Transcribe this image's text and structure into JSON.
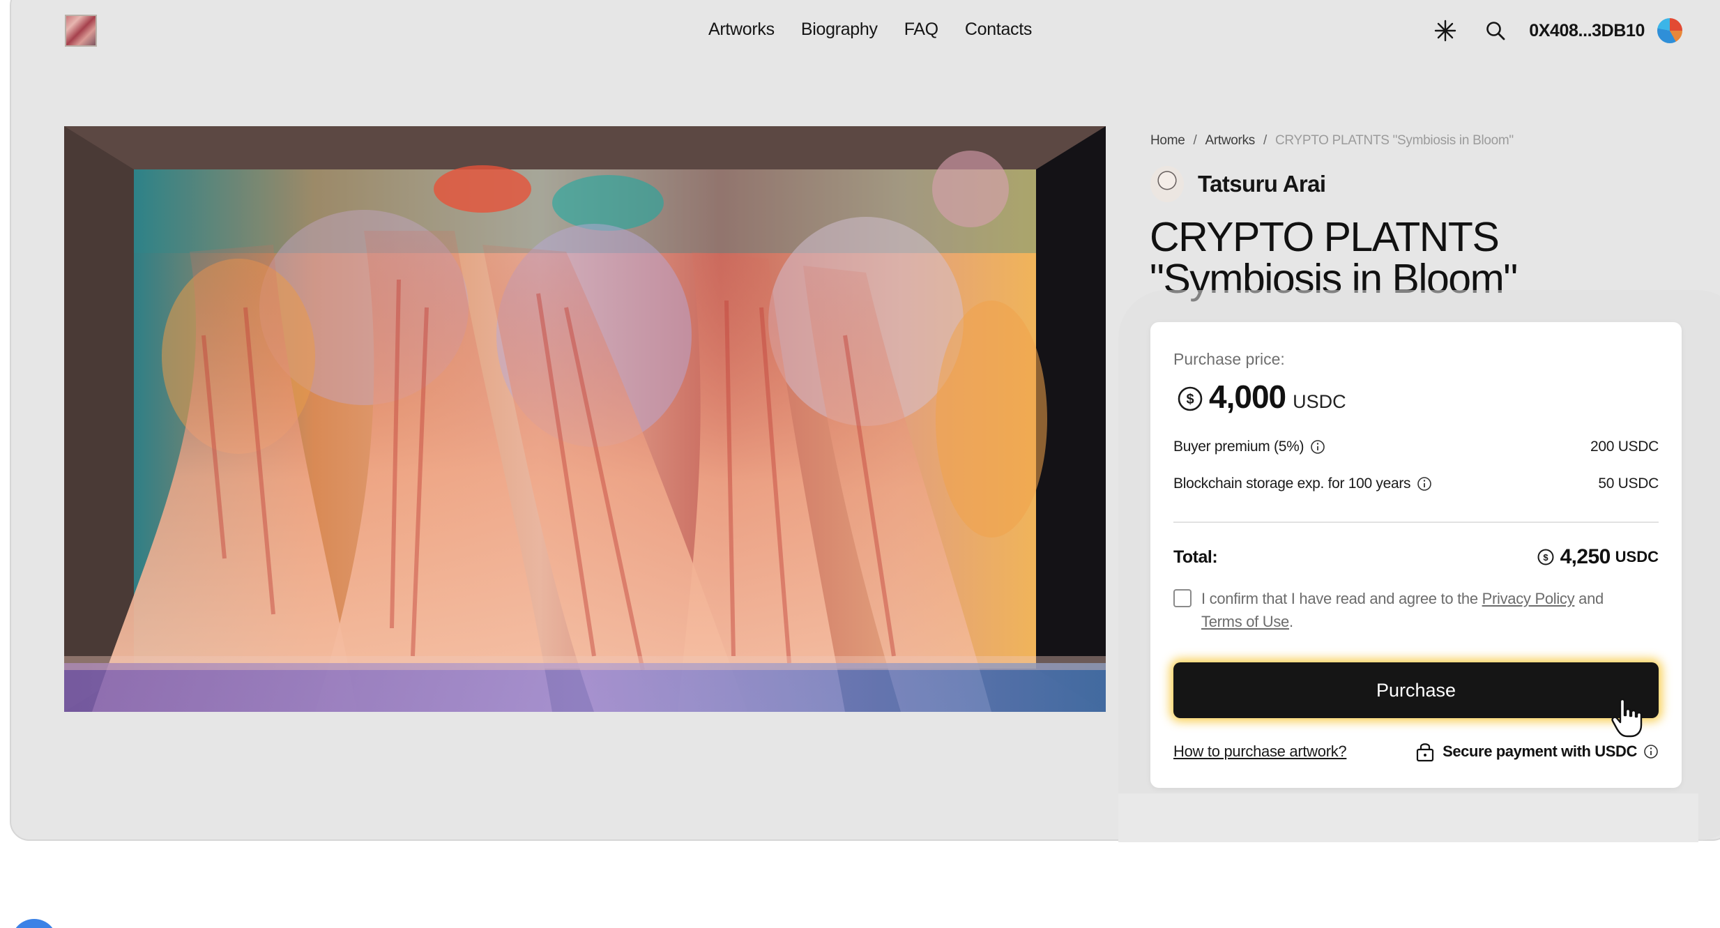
{
  "nav": {
    "items": [
      "Artworks",
      "Biography",
      "FAQ",
      "Contacts"
    ],
    "wallet": "0X408...3DB10"
  },
  "breadcrumb": {
    "home": "Home",
    "separator": "/",
    "section": "Artworks",
    "current": "CRYPTO PLATNTS \"Symbiosis in Bloom\""
  },
  "artist": {
    "name": "Tatsuru Arai"
  },
  "artwork": {
    "title_line1": "CRYPTO PLATNTS",
    "title_line2": "\"Symbiosis in Bloom\""
  },
  "purchase": {
    "price_label": "Purchase price:",
    "price": "4,000",
    "currency": "USDC",
    "fees": [
      {
        "label": "Buyer premium (5%)",
        "value": "200 USDC"
      },
      {
        "label": "Blockchain storage exp. for 100 years",
        "value": "50 USDC"
      }
    ],
    "total_label": "Total:",
    "total": "4,250",
    "total_currency": "USDC",
    "consent_prefix": "I confirm that I have read and agree to the ",
    "privacy_link": "Privacy Policy",
    "consent_and": " and ",
    "terms_link": "Terms of Use",
    "consent_suffix": ".",
    "checkbox_checked": false,
    "button_label": "Purchase",
    "howto_link": "How to purchase artwork?",
    "secure_label": "Secure payment with USDC"
  },
  "colors": {
    "frame": "#e6e6e6",
    "button": "#151515",
    "button_glow": "#f7c01e"
  },
  "icons": [
    "sun-icon",
    "search-icon",
    "usdc-coin-icon",
    "info-icon",
    "lock-icon",
    "hand-cursor-icon"
  ]
}
